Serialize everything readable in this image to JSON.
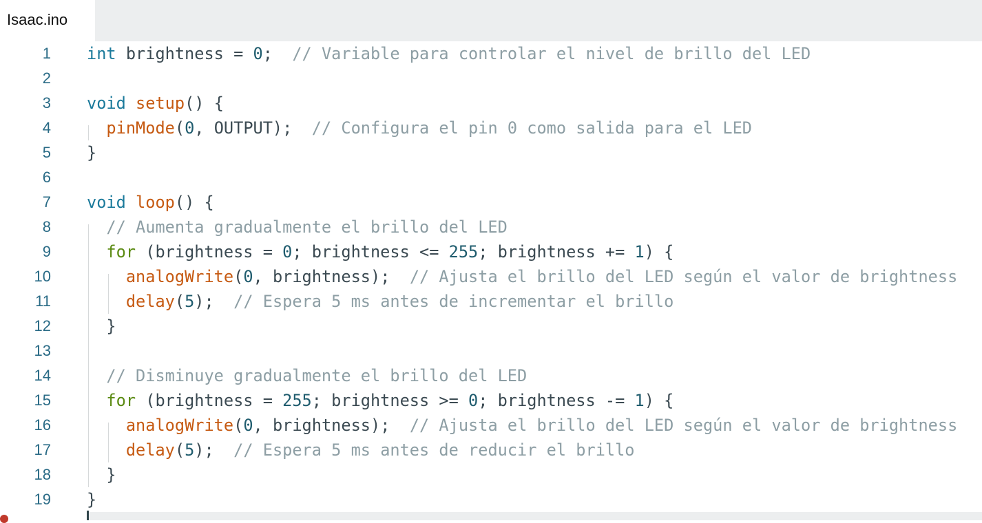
{
  "tab": {
    "filename": "Isaac.ino"
  },
  "lines": [
    {
      "n": "1",
      "tokens": [
        [
          "kw",
          "int"
        ],
        [
          "tx",
          " brightness = "
        ],
        [
          "num",
          "0"
        ],
        [
          "tx",
          ";  "
        ],
        [
          "cm",
          "// Variable para controlar el nivel de brillo del LED"
        ]
      ]
    },
    {
      "n": "2",
      "tokens": []
    },
    {
      "n": "3",
      "tokens": [
        [
          "kw",
          "void"
        ],
        [
          "tx",
          " "
        ],
        [
          "fn",
          "setup"
        ],
        [
          "tx",
          "() {"
        ]
      ]
    },
    {
      "n": "4",
      "tokens": [
        [
          "tx",
          "  "
        ],
        [
          "fn",
          "pinMode"
        ],
        [
          "tx",
          "("
        ],
        [
          "num",
          "0"
        ],
        [
          "tx",
          ", OUTPUT);  "
        ],
        [
          "cm",
          "// Configura el pin 0 como salida para el LED"
        ]
      ]
    },
    {
      "n": "5",
      "tokens": [
        [
          "tx",
          "}"
        ]
      ]
    },
    {
      "n": "6",
      "tokens": []
    },
    {
      "n": "7",
      "tokens": [
        [
          "kw",
          "void"
        ],
        [
          "tx",
          " "
        ],
        [
          "fn",
          "loop"
        ],
        [
          "tx",
          "() {"
        ]
      ]
    },
    {
      "n": "8",
      "tokens": [
        [
          "tx",
          "  "
        ],
        [
          "cm",
          "// Aumenta gradualmente el brillo del LED"
        ]
      ]
    },
    {
      "n": "9",
      "tokens": [
        [
          "tx",
          "  "
        ],
        [
          "kw2",
          "for"
        ],
        [
          "tx",
          " (brightness = "
        ],
        [
          "num",
          "0"
        ],
        [
          "tx",
          "; brightness <= "
        ],
        [
          "num",
          "255"
        ],
        [
          "tx",
          "; brightness += "
        ],
        [
          "num",
          "1"
        ],
        [
          "tx",
          ") {"
        ]
      ]
    },
    {
      "n": "10",
      "tokens": [
        [
          "tx",
          "    "
        ],
        [
          "fn",
          "analogWrite"
        ],
        [
          "tx",
          "("
        ],
        [
          "num",
          "0"
        ],
        [
          "tx",
          ", brightness);  "
        ],
        [
          "cm",
          "// Ajusta el brillo del LED según el valor de brightness"
        ]
      ]
    },
    {
      "n": "11",
      "tokens": [
        [
          "tx",
          "    "
        ],
        [
          "fn",
          "delay"
        ],
        [
          "tx",
          "("
        ],
        [
          "num",
          "5"
        ],
        [
          "tx",
          ");  "
        ],
        [
          "cm",
          "// Espera 5 ms antes de incrementar el brillo"
        ]
      ]
    },
    {
      "n": "12",
      "tokens": [
        [
          "tx",
          "  }"
        ]
      ]
    },
    {
      "n": "13",
      "tokens": []
    },
    {
      "n": "14",
      "tokens": [
        [
          "tx",
          "  "
        ],
        [
          "cm",
          "// Disminuye gradualmente el brillo del LED"
        ]
      ]
    },
    {
      "n": "15",
      "tokens": [
        [
          "tx",
          "  "
        ],
        [
          "kw2",
          "for"
        ],
        [
          "tx",
          " (brightness = "
        ],
        [
          "num",
          "255"
        ],
        [
          "tx",
          "; brightness >= "
        ],
        [
          "num",
          "0"
        ],
        [
          "tx",
          "; brightness -= "
        ],
        [
          "num",
          "1"
        ],
        [
          "tx",
          ") {"
        ]
      ]
    },
    {
      "n": "16",
      "tokens": [
        [
          "tx",
          "    "
        ],
        [
          "fn",
          "analogWrite"
        ],
        [
          "tx",
          "("
        ],
        [
          "num",
          "0"
        ],
        [
          "tx",
          ", brightness);  "
        ],
        [
          "cm",
          "// Ajusta el brillo del LED según el valor de brightness"
        ]
      ]
    },
    {
      "n": "17",
      "tokens": [
        [
          "tx",
          "    "
        ],
        [
          "fn",
          "delay"
        ],
        [
          "tx",
          "("
        ],
        [
          "num",
          "5"
        ],
        [
          "tx",
          ");  "
        ],
        [
          "cm",
          "// Espera 5 ms antes de reducir el brillo"
        ]
      ]
    },
    {
      "n": "18",
      "tokens": [
        [
          "tx",
          "  }"
        ]
      ]
    },
    {
      "n": "19",
      "tokens": [
        [
          "tx",
          "}"
        ]
      ]
    }
  ]
}
